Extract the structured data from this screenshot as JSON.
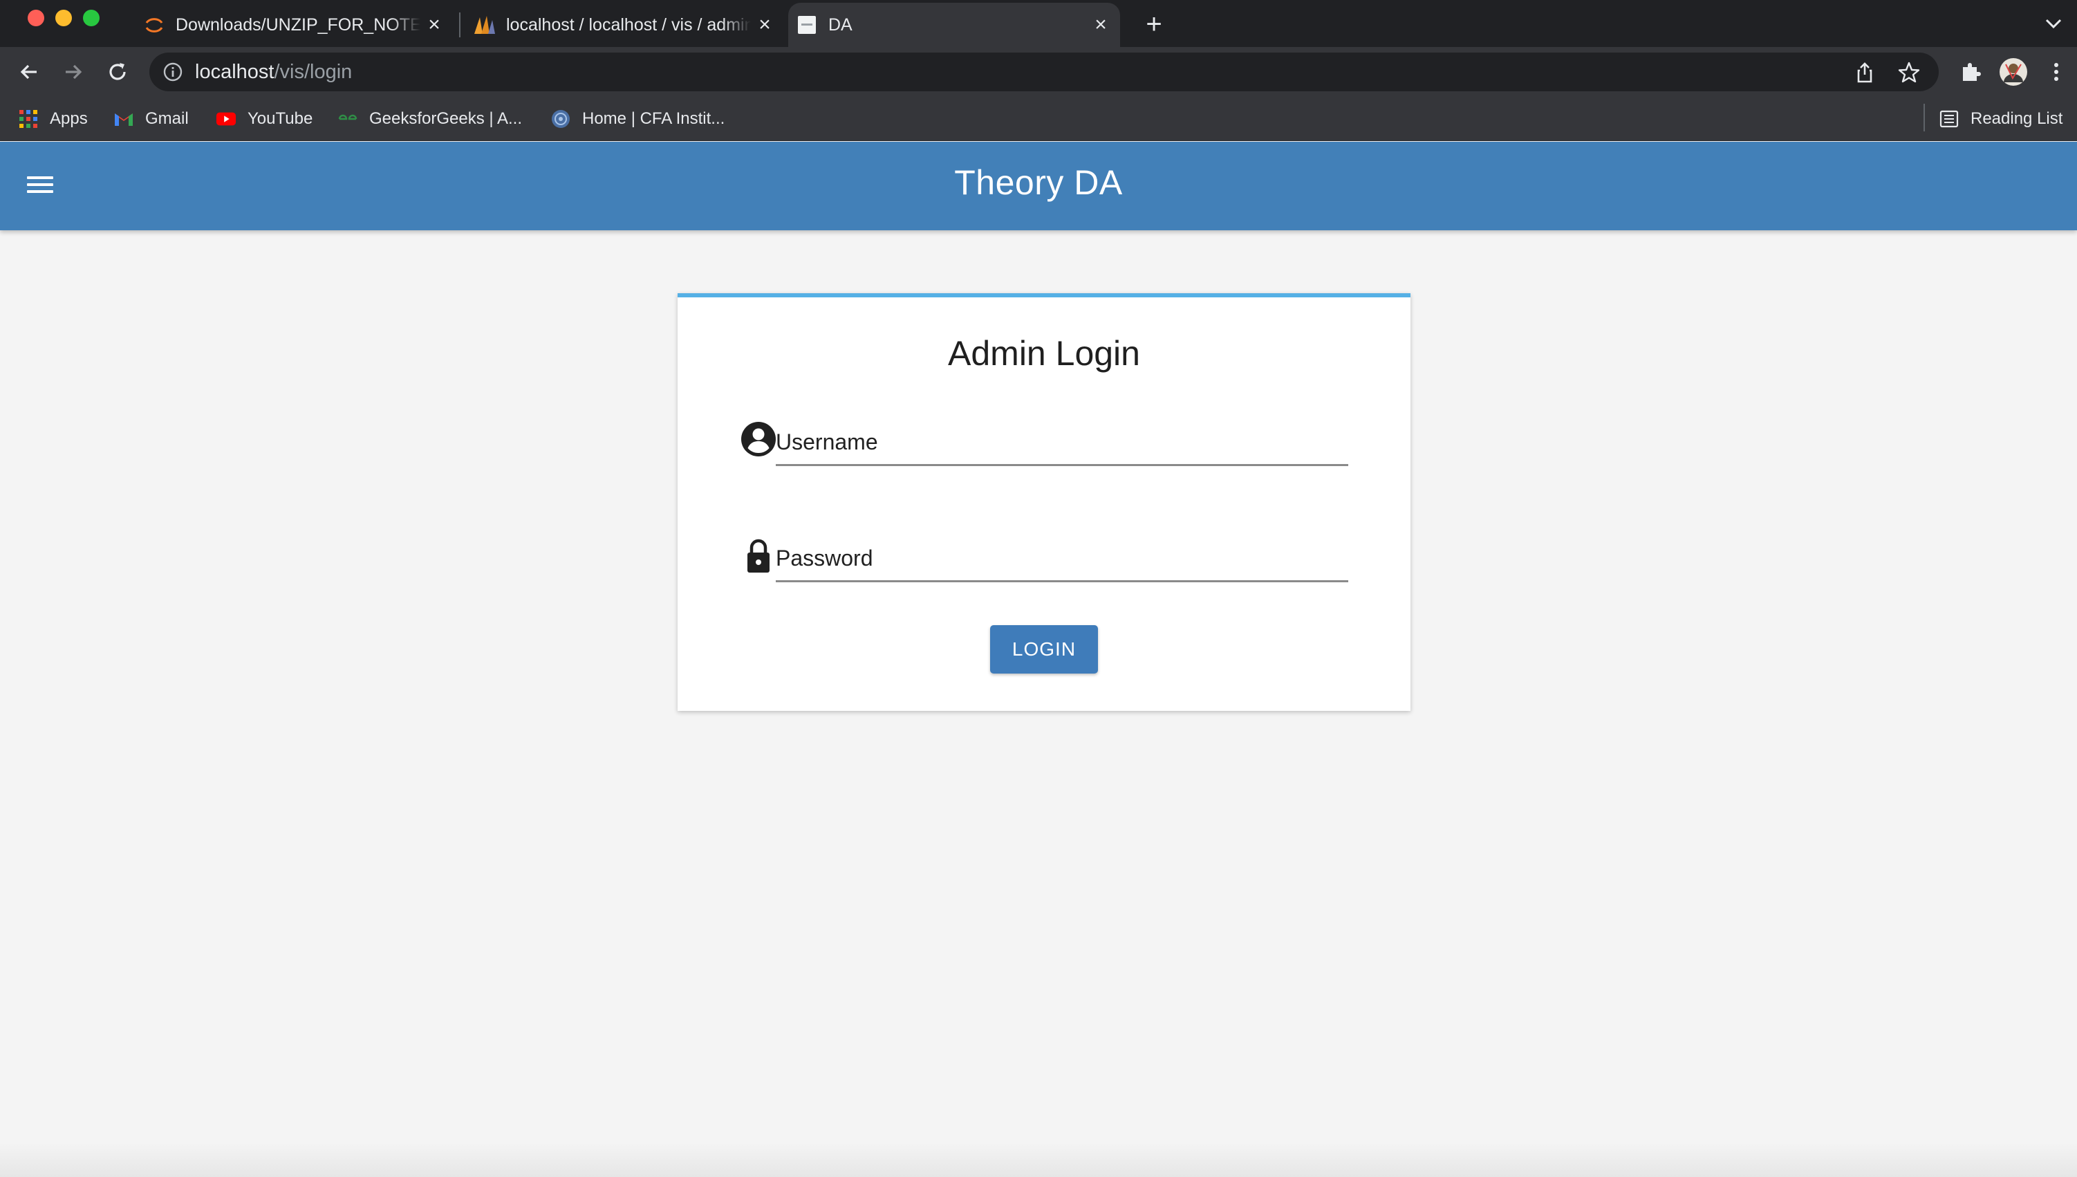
{
  "browser": {
    "tabs": [
      {
        "title": "Downloads/UNZIP_FOR_NOTEBOOKS",
        "active": false
      },
      {
        "title": "localhost / localhost / vis / admin",
        "active": false
      },
      {
        "title": "DA",
        "active": true
      }
    ],
    "address": {
      "host": "localhost",
      "path": "/vis/login"
    },
    "bookmarks": [
      {
        "label": "Apps",
        "icon": "apps-grid-icon"
      },
      {
        "label": "Gmail",
        "icon": "gmail-icon"
      },
      {
        "label": "YouTube",
        "icon": "youtube-icon"
      },
      {
        "label": "GeeksforGeeks | A...",
        "icon": "geeksforgeeks-icon"
      },
      {
        "label": "Home | CFA Instit...",
        "icon": "cfa-icon"
      }
    ],
    "reading_list": "Reading List"
  },
  "app": {
    "title": "Theory DA",
    "colors": {
      "appbar": "#4280b8",
      "card_accent": "#55b0e5",
      "button": "#3f7cba",
      "background": "#f4f4f4"
    }
  },
  "login": {
    "heading": "Admin Login",
    "username_placeholder": "Username",
    "password_placeholder": "Password",
    "button_label": "LOGIN"
  }
}
